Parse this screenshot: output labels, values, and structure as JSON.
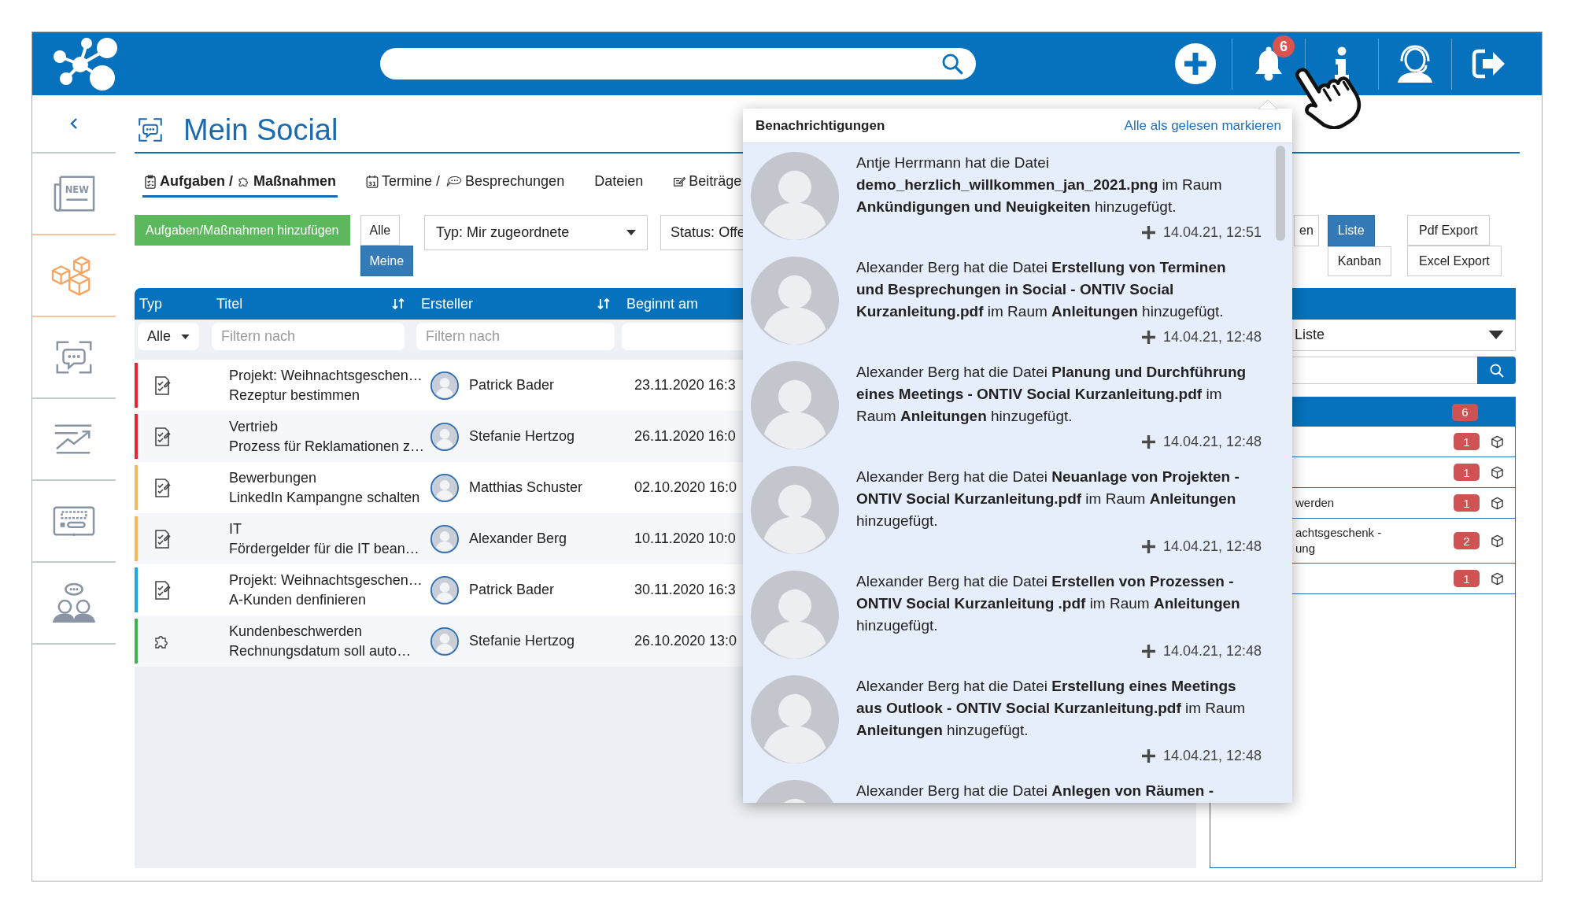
{
  "topbar": {
    "notification_count": "6"
  },
  "sidebar": {
    "items": [
      {
        "kind": "news",
        "label": "NEW",
        "selected": false
      },
      {
        "kind": "cubes",
        "selected": true
      },
      {
        "kind": "social",
        "selected": false
      },
      {
        "kind": "chart",
        "selected": false
      },
      {
        "kind": "board",
        "selected": false
      },
      {
        "kind": "team",
        "selected": false
      }
    ]
  },
  "page": {
    "title": "Mein Social"
  },
  "tabs": [
    {
      "kind": "tasks",
      "segments": [
        "Aufgaben /",
        "Maßnahmen"
      ],
      "selected": true
    },
    {
      "kind": "meetings",
      "icon_text": "31",
      "segments": [
        "Termine /",
        "Besprechungen"
      ],
      "selected": false
    },
    {
      "kind": "files",
      "segments": [
        "Dateien"
      ],
      "selected": false
    },
    {
      "kind": "posts",
      "segments": [
        "Beiträge"
      ],
      "selected": false
    }
  ],
  "toolbar": {
    "add_button": "Aufgaben/Maßnahmen hinzufügen",
    "scope": [
      {
        "label": "Alle",
        "selected": false
      },
      {
        "label": "Meine",
        "selected": true
      }
    ],
    "type_filter": "Typ: Mir zugeordnete",
    "status_filter": "Status: Offe",
    "views": [
      {
        "label": "en",
        "selected": false
      },
      {
        "label": "Liste",
        "selected": true
      },
      {
        "label": "Kanban",
        "selected": false
      }
    ],
    "exports": [
      "Pdf Export",
      "Excel Export"
    ]
  },
  "table": {
    "columns": [
      {
        "label": "Typ",
        "sortable": false
      },
      {
        "label": "Titel",
        "sortable": true
      },
      {
        "label": "Ersteller",
        "sortable": true
      },
      {
        "label": "Beginnt am",
        "sortable": false
      }
    ],
    "filters": [
      {
        "kind": "select",
        "value": "Alle"
      },
      {
        "kind": "text",
        "placeholder": "Filtern nach"
      },
      {
        "kind": "text",
        "placeholder": "Filtern nach"
      },
      {
        "kind": "text"
      }
    ],
    "rows": [
      {
        "kind": "task",
        "color": "#e8262b",
        "group": "Projekt: Weihnachtsgeschen…",
        "title": "Rezeptur bestimmen",
        "creator": "Patrick Bader",
        "start": "23.11.2020 16:3"
      },
      {
        "kind": "task",
        "color": "#e8262b",
        "group": "Vertrieb",
        "title": "Prozess für Reklamationen z…",
        "creator": "Stefanie Hertzog",
        "start": "26.11.2020 16:0"
      },
      {
        "kind": "task",
        "color": "#f7b55c",
        "group": "Bewerbungen",
        "title": "LinkedIn Kampangne schalten",
        "creator": "Matthias Schuster",
        "start": "02.10.2020 16:0"
      },
      {
        "kind": "task",
        "color": "#f7b55c",
        "group": "IT",
        "title": "Fördergelder für die IT bean…",
        "creator": "Alexander Berg",
        "start": "10.11.2020 10:0"
      },
      {
        "kind": "task",
        "color": "#1aa7e6",
        "group": "Projekt: Weihnachtsgeschen…",
        "title": "A-Kunden denfinieren",
        "creator": "Patrick Bader",
        "start": "30.11.2020 16:3"
      },
      {
        "kind": "measure",
        "color": "#3db54a",
        "group": "Kundenbeschwerden",
        "title": "Rechnungsdatum soll auto…",
        "creator": "Stefanie Hertzog",
        "start": "26.10.2020 13:0"
      }
    ]
  },
  "side_panel": {
    "view_select": "Liste",
    "total": "6",
    "items": [
      {
        "count": "1"
      },
      {
        "count": "1"
      },
      {
        "lines": [
          "werden"
        ],
        "count": "1"
      },
      {
        "lines": [
          "achtsgeschenk -",
          "ung"
        ],
        "count": "2"
      },
      {
        "count": "1"
      }
    ]
  },
  "notifications": {
    "title": "Benachrichtigungen",
    "mark_all": "Alle als gelesen markieren",
    "items": [
      {
        "text": "Antje Herrmann hat die Datei **demo_herzlich_willkommen_jan_2021.png** im Raum **Ankündigungen und Neuigkeiten** hinzugefügt.",
        "time": "14.04.21, 12:51"
      },
      {
        "text": "Alexander Berg hat die Datei **Erstellung von Terminen und Besprechungen in Social - ONTIV Social Kurzanleitung.pdf** im Raum **Anleitungen** hinzugefügt.",
        "time": "14.04.21, 12:48"
      },
      {
        "text": "Alexander Berg hat die Datei **Planung und Durchführung eines Meetings - ONTIV Social Kurzanleitung.pdf** im Raum **Anleitungen** hinzugefügt.",
        "time": "14.04.21, 12:48"
      },
      {
        "text": "Alexander Berg hat die Datei **Neuanlage von Projekten - ONTIV Social Kurzanleitung.pdf** im Raum **Anleitungen** hinzugefügt.",
        "time": "14.04.21, 12:48"
      },
      {
        "text": "Alexander Berg hat die Datei **Erstellen von Prozessen - ONTIV Social Kurzanleitung .pdf** im Raum **Anleitungen** hinzugefügt.",
        "time": "14.04.21, 12:48"
      },
      {
        "text": "Alexander Berg hat die Datei **Erstellung eines Meetings aus Outlook - ONTIV Social Kurzanleitung.pdf** im Raum **Anleitungen** hinzugefügt.",
        "time": "14.04.21, 12:48"
      },
      {
        "text": "Alexander Berg hat die Datei **Anlegen von Räumen -**"
      }
    ]
  }
}
